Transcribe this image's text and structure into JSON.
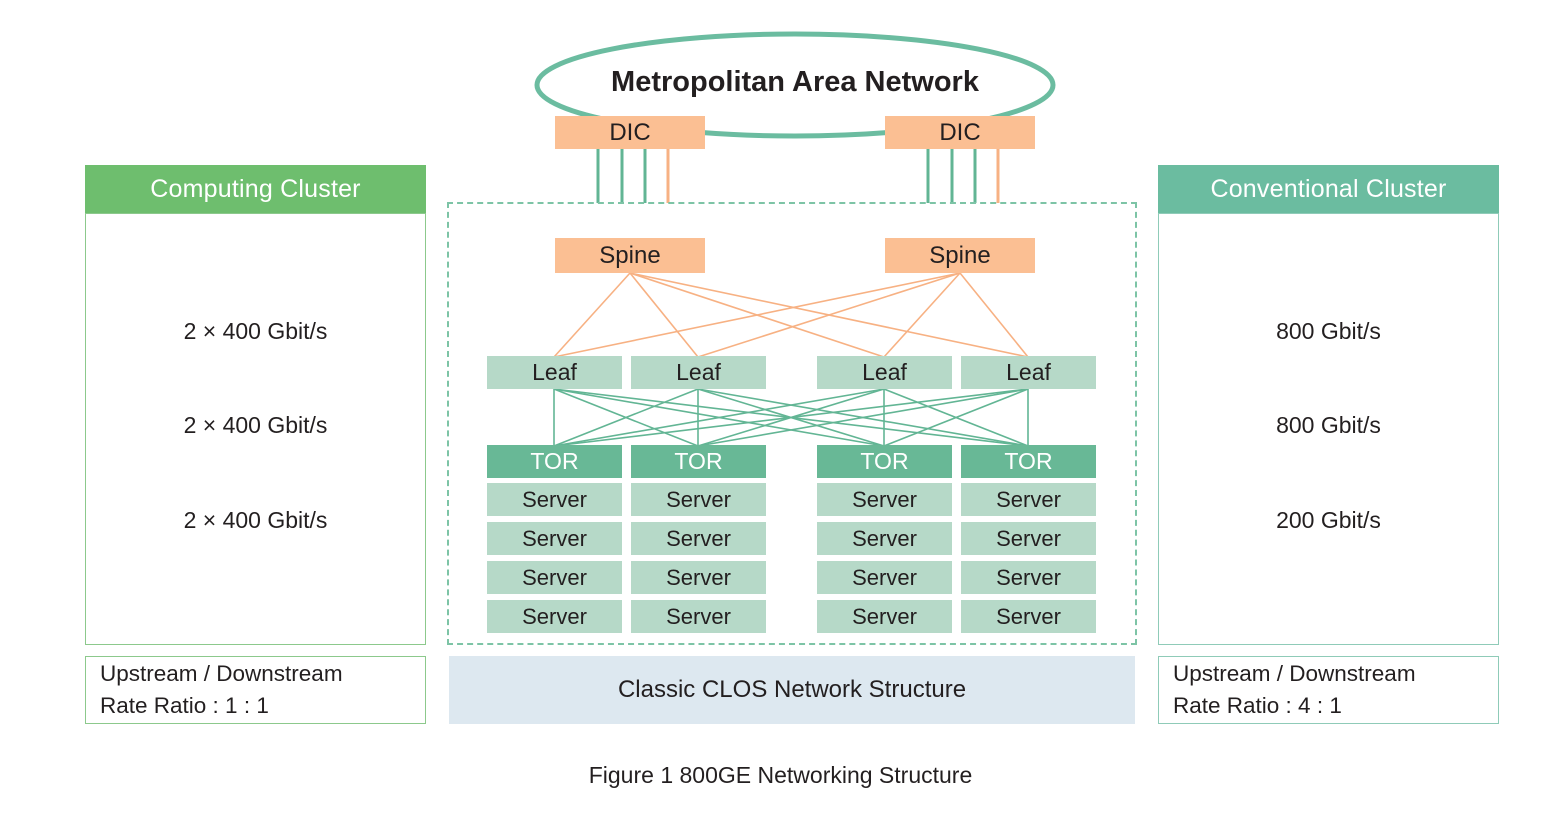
{
  "figure": {
    "caption": "Figure 1 800GE Networking Structure"
  },
  "network": {
    "man_label": "Metropolitan Area Network",
    "dic_label": "DIC",
    "dic_nodes": [
      "DIC",
      "DIC"
    ],
    "spine_label": "Spine",
    "spine_nodes": [
      "Spine",
      "Spine"
    ],
    "leaf_label": "Leaf",
    "leaf_nodes": [
      "Leaf",
      "Leaf",
      "Leaf",
      "Leaf"
    ],
    "tor_label": "TOR",
    "server_label": "Server",
    "racks": [
      {
        "tor": "TOR",
        "servers": [
          "Server",
          "Server",
          "Server",
          "Server"
        ]
      },
      {
        "tor": "TOR",
        "servers": [
          "Server",
          "Server",
          "Server",
          "Server"
        ]
      },
      {
        "tor": "TOR",
        "servers": [
          "Server",
          "Server",
          "Server",
          "Server"
        ]
      },
      {
        "tor": "TOR",
        "servers": [
          "Server",
          "Server",
          "Server",
          "Server"
        ]
      }
    ],
    "clos_caption": "Classic CLOS Network Structure"
  },
  "left_panel": {
    "title": "Computing Cluster",
    "rates": [
      "2 × 400 Gbit/s",
      "2 × 400 Gbit/s",
      "2 × 400 Gbit/s"
    ],
    "ratio_line1": "Upstream / Downstream",
    "ratio_line2": "Rate Ratio : 1 : 1"
  },
  "right_panel": {
    "title": "Conventional Cluster",
    "rates": [
      "800 Gbit/s",
      "800 Gbit/s",
      "200 Gbit/s"
    ],
    "ratio_line1": "Upstream / Downstream",
    "ratio_line2": "Rate Ratio : 4 : 1"
  },
  "colors": {
    "left_header_green": "#6ebe6e",
    "right_header_green": "#6bbca0",
    "peach": "#fbbf93",
    "leaf_green": "#b6d9c8",
    "tor_green": "#68b896",
    "clos_bar_blue": "#dde8f0",
    "dashed_border": "#7dc4a6",
    "orange_link": "#f7b183",
    "green_link": "#62b594",
    "ellipse_stroke": "#6bbca0"
  }
}
